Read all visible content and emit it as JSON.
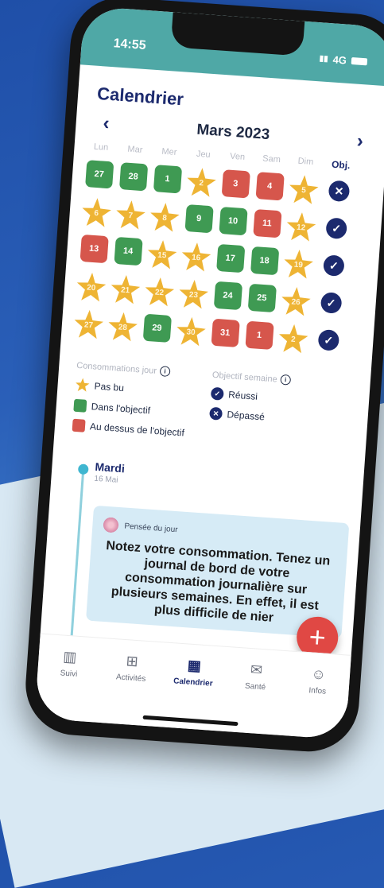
{
  "status": {
    "time": "14:55",
    "network": "4G"
  },
  "header": {
    "title": "Calendrier"
  },
  "calendar": {
    "month_label": "Mars 2023",
    "prev_icon": "chevron-left-icon",
    "next_icon": "chevron-right-icon",
    "weekdays": [
      "Lun",
      "Mar",
      "Mer",
      "Jeu",
      "Ven",
      "Sam",
      "Dim"
    ],
    "obj_header": "Obj.",
    "weeks": [
      {
        "days": [
          {
            "n": "27",
            "t": "green"
          },
          {
            "n": "28",
            "t": "green"
          },
          {
            "n": "1",
            "t": "green"
          },
          {
            "n": "2",
            "t": "star"
          },
          {
            "n": "3",
            "t": "red"
          },
          {
            "n": "4",
            "t": "red"
          },
          {
            "n": "5",
            "t": "star"
          }
        ],
        "obj": "depasse"
      },
      {
        "days": [
          {
            "n": "6",
            "t": "star"
          },
          {
            "n": "7",
            "t": "star"
          },
          {
            "n": "8",
            "t": "star"
          },
          {
            "n": "9",
            "t": "green"
          },
          {
            "n": "10",
            "t": "green"
          },
          {
            "n": "11",
            "t": "red"
          },
          {
            "n": "12",
            "t": "star"
          }
        ],
        "obj": "reussi"
      },
      {
        "days": [
          {
            "n": "13",
            "t": "red"
          },
          {
            "n": "14",
            "t": "green"
          },
          {
            "n": "15",
            "t": "star"
          },
          {
            "n": "16",
            "t": "star"
          },
          {
            "n": "17",
            "t": "green"
          },
          {
            "n": "18",
            "t": "green"
          },
          {
            "n": "19",
            "t": "star"
          }
        ],
        "obj": "reussi"
      },
      {
        "days": [
          {
            "n": "20",
            "t": "star"
          },
          {
            "n": "21",
            "t": "star"
          },
          {
            "n": "22",
            "t": "star"
          },
          {
            "n": "23",
            "t": "star"
          },
          {
            "n": "24",
            "t": "green"
          },
          {
            "n": "25",
            "t": "green"
          },
          {
            "n": "26",
            "t": "star"
          }
        ],
        "obj": "reussi"
      },
      {
        "days": [
          {
            "n": "27",
            "t": "star"
          },
          {
            "n": "28",
            "t": "star"
          },
          {
            "n": "29",
            "t": "green"
          },
          {
            "n": "30",
            "t": "star"
          },
          {
            "n": "31",
            "t": "red"
          },
          {
            "n": "1",
            "t": "red"
          },
          {
            "n": "2",
            "t": "star"
          }
        ],
        "obj": "reussi"
      }
    ],
    "colors": {
      "green": "#3f9a53",
      "red": "#d6564c",
      "star": "#eeb434",
      "navy": "#1c2a6e"
    }
  },
  "legend": {
    "consumption_title": "Consommations jour",
    "items": [
      "Pas bu",
      "Dans l'objectif",
      "Au dessus de l'objectif"
    ],
    "weekly_title": "Objectif semaine",
    "weekly_items": [
      "Réussi",
      "Dépassé"
    ]
  },
  "timeline": {
    "day_name": "Mardi",
    "day_date": "16 Mai",
    "thought_label": "Pensée du jour",
    "thought_text": "Notez votre consommation. Tenez un journal de bord de votre consommation journalière sur plusieurs semaines. En effet, il est plus difficile de nier"
  },
  "tabs": [
    {
      "label": "Suivi",
      "icon": "tracking-icon"
    },
    {
      "label": "Activités",
      "icon": "activities-grid-icon"
    },
    {
      "label": "Calendrier",
      "icon": "calendar-icon",
      "active": true
    },
    {
      "label": "Santé",
      "icon": "health-chat-icon"
    },
    {
      "label": "Infos",
      "icon": "info-person-icon"
    }
  ]
}
